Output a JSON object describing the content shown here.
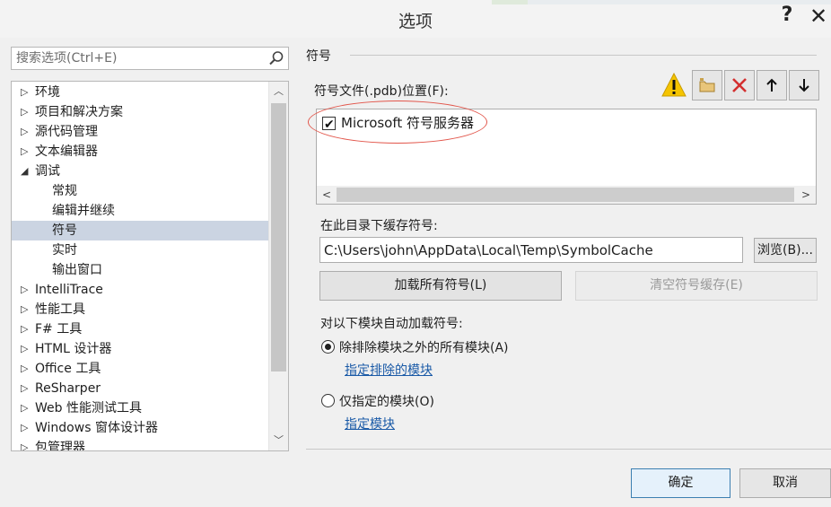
{
  "dialog": {
    "title": "选项",
    "help_label": "?",
    "close_label": "✕"
  },
  "search": {
    "placeholder": "搜索选项(Ctrl+E)",
    "icon": "search-icon"
  },
  "tree": {
    "items": [
      {
        "label": "环境",
        "arrow": "▷"
      },
      {
        "label": "项目和解决方案",
        "arrow": "▷"
      },
      {
        "label": "源代码管理",
        "arrow": "▷"
      },
      {
        "label": "文本编辑器",
        "arrow": "▷"
      },
      {
        "label": "调试",
        "arrow": "◢"
      },
      {
        "label": "常规",
        "arrow": ""
      },
      {
        "label": "编辑并继续",
        "arrow": ""
      },
      {
        "label": "符号",
        "arrow": ""
      },
      {
        "label": "实时",
        "arrow": ""
      },
      {
        "label": "输出窗口",
        "arrow": ""
      },
      {
        "label": "IntelliTrace",
        "arrow": "▷"
      },
      {
        "label": "性能工具",
        "arrow": "▷"
      },
      {
        "label": "F# 工具",
        "arrow": "▷"
      },
      {
        "label": "HTML 设计器",
        "arrow": "▷"
      },
      {
        "label": "Office 工具",
        "arrow": "▷"
      },
      {
        "label": "ReSharper",
        "arrow": "▷"
      },
      {
        "label": "Web 性能测试工具",
        "arrow": "▷"
      },
      {
        "label": "Windows 窗体设计器",
        "arrow": "▷"
      },
      {
        "label": "包管理器",
        "arrow": "▷"
      }
    ],
    "selected": "符号"
  },
  "symbols": {
    "section_title": "符号",
    "pdb_location_label": "符号文件(.pdb)位置(F):",
    "toolbar": {
      "warning_icon": "warning-icon",
      "new_folder_icon": "new-folder-icon",
      "delete_icon": "delete-icon",
      "move_up_icon": "arrow-up-icon",
      "move_down_icon": "arrow-down-icon"
    },
    "servers": [
      {
        "label": "Microsoft 符号服务器",
        "checked": true
      }
    ],
    "cache_label": "在此目录下缓存符号:",
    "cache_path": "C:\\Users\\john\\AppData\\Local\\Temp\\SymbolCache",
    "browse_label": "浏览(B)...",
    "load_all_label": "加载所有符号(L)",
    "clear_cache_label": "清空符号缓存(E)",
    "auto_load_label": "对以下模块自动加载符号:",
    "option_all_label": "除排除模块之外的所有模块(A)",
    "option_all_selected": true,
    "link_excluded_label": "指定排除的模块",
    "option_specified_label": "仅指定的模块(O)",
    "link_specified_label": "指定模块"
  },
  "footer": {
    "ok_label": "确定",
    "cancel_label": "取消"
  },
  "colors": {
    "selection": "#cbd4e2",
    "link": "#1a5aa7",
    "annotation_ellipse": "#e2554a",
    "delete_red": "#d32f2f",
    "warning_yellow": "#f5c400"
  }
}
